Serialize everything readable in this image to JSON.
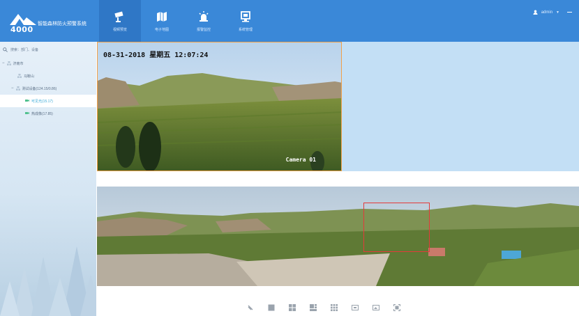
{
  "header": {
    "app_title": "智能森林防火预警系统",
    "logo_number": "4000",
    "nav": [
      {
        "label": "视频预览",
        "icon": "camera-icon",
        "active": true
      },
      {
        "label": "电子地图",
        "icon": "map-icon",
        "active": false
      },
      {
        "label": "报警监控",
        "icon": "alarm-icon",
        "active": false
      },
      {
        "label": "系统管理",
        "icon": "settings-monitor-icon",
        "active": false
      }
    ],
    "user": {
      "name": "admin",
      "icon": "user-icon"
    },
    "colors": {
      "bar": "#3a88d8",
      "active_tab": "#2f77c6"
    }
  },
  "sidebar": {
    "search_placeholder": "搜索：部门、设备",
    "tree": [
      {
        "label": "济南市",
        "level": 0,
        "icon": "org-icon",
        "expanded": true
      },
      {
        "label": "马鞍山",
        "level": 1,
        "icon": "org-icon"
      },
      {
        "label": "测试设备(124.15/0.86)",
        "level": 1,
        "icon": "org-icon",
        "expanded": true
      },
      {
        "label": "可见光(15.17)",
        "level": 2,
        "icon": "camera-node-icon",
        "selected": true
      },
      {
        "label": "热成像(17.85)",
        "level": 2,
        "icon": "camera-node-icon"
      }
    ]
  },
  "video": {
    "timestamp": "08-31-2018 星期五 12:07:24",
    "camera_label": "Camera 01"
  },
  "toolbar": {
    "icons": [
      "ptz-icon",
      "layout-1-icon",
      "layout-4-icon",
      "layout-6-icon",
      "layout-9-icon",
      "record-icon",
      "snapshot-icon",
      "fullscreen-icon"
    ]
  }
}
